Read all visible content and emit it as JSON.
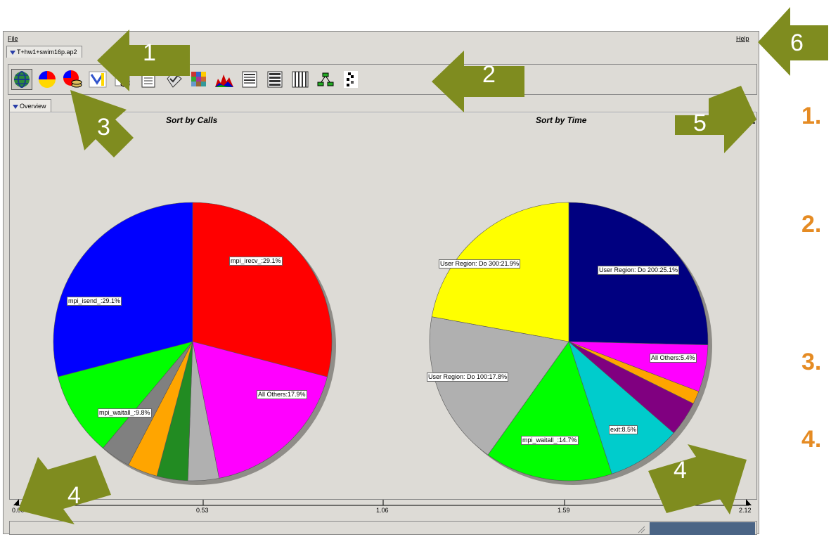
{
  "menu": {
    "file": "File",
    "help": "Help"
  },
  "file_tab": {
    "label": "T+hw1+swim16p.ap2"
  },
  "overview_tab": {
    "label": "Overview"
  },
  "left_chart": {
    "title": "Sort by Calls"
  },
  "right_chart": {
    "title": "Sort by Time"
  },
  "chart_data": [
    {
      "type": "pie",
      "title": "Sort by Calls",
      "slices": [
        {
          "label": "mpi_irecv_:29.1%",
          "value": 29.1,
          "color": "#ff0000"
        },
        {
          "label": "All Others:17.9%",
          "value": 17.9,
          "color": "#ff00ff"
        },
        {
          "label": "",
          "value": 3.6,
          "color": "#b0b0b0"
        },
        {
          "label": "",
          "value": 3.6,
          "color": "#228b22"
        },
        {
          "label": "",
          "value": 3.5,
          "color": "#ffa500"
        },
        {
          "label": "",
          "value": 3.5,
          "color": "#808080"
        },
        {
          "label": "mpi_waitall_:9.8%",
          "value": 9.8,
          "color": "#00ff00"
        },
        {
          "label": "mpi_isend_:29.1%",
          "value": 29.1,
          "color": "#0000ff"
        }
      ]
    },
    {
      "type": "pie",
      "title": "Sort by Time",
      "slices": [
        {
          "label": "User Region: Do 200:25.1%",
          "value": 25.1,
          "color": "#000080"
        },
        {
          "label": "All Others:5.4%",
          "value": 5.4,
          "color": "#ff00ff"
        },
        {
          "label": "",
          "value": 1.5,
          "color": "#ffa500"
        },
        {
          "label": "",
          "value": 4.0,
          "color": "#800080"
        },
        {
          "label": "exit:8.5%",
          "value": 8.5,
          "color": "#00cccc"
        },
        {
          "label": "mpi_waitall_:14.7%",
          "value": 14.7,
          "color": "#00ff00"
        },
        {
          "label": "User Region: Do 100:17.8%",
          "value": 17.8,
          "color": "#b0b0b0"
        },
        {
          "label": "User Region: Do 300:21.9%",
          "value": 21.9,
          "color": "#ffff00"
        }
      ]
    }
  ],
  "timeline": {
    "ticks": [
      "0.00",
      "0.53",
      "1.06",
      "1.59",
      "2.12"
    ]
  },
  "toolbar_icons": [
    "globe-icon",
    "pie-chart-icon",
    "pie-stack-icon",
    "filter-icon",
    "stack-icon",
    "list-icon",
    "checklist-icon",
    "grid-color-icon",
    "area-chart-icon",
    "text-icon",
    "table-icon",
    "columns-icon",
    "tree-icon",
    "pattern-icon"
  ],
  "callouts": {
    "n1": "1",
    "n2": "2",
    "n3": "3",
    "n4a": "4",
    "n4b": "4",
    "n5": "5",
    "n6": "6"
  },
  "side_numbers": [
    "1.",
    "2.",
    "3.",
    "4."
  ],
  "colors": {
    "arrow": "#7f8c1f",
    "accent_number": "#e58b23"
  }
}
